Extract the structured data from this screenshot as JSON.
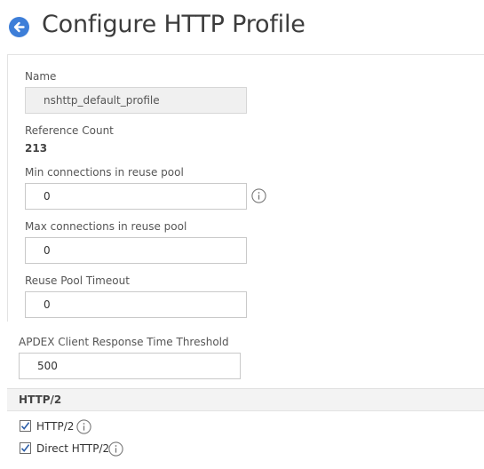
{
  "header": {
    "title": "Configure HTTP Profile",
    "back_icon": "arrow-left-circle-icon",
    "accent": "#3d7ed8"
  },
  "form": {
    "name": {
      "label": "Name",
      "value": "nshttp_default_profile"
    },
    "reference_count": {
      "label": "Reference Count",
      "value": "213"
    },
    "min_conn": {
      "label": "Min connections in reuse pool",
      "value": "0"
    },
    "max_conn": {
      "label": "Max connections in reuse pool",
      "value": "0"
    },
    "reuse_timeout": {
      "label": "Reuse Pool Timeout",
      "value": "0"
    },
    "apdex": {
      "label": "APDEX Client Response Time Threshold",
      "value": "500"
    }
  },
  "http2": {
    "section_title": "HTTP/2",
    "options": [
      {
        "label": "HTTP/2",
        "checked": true
      },
      {
        "label": "Direct HTTP/2",
        "checked": true
      }
    ]
  }
}
